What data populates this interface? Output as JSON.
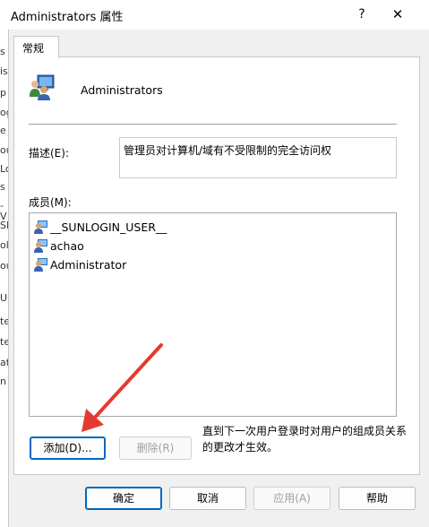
{
  "window": {
    "title": "Administrators 属性",
    "help_glyph": "?",
    "close_glyph": "✕"
  },
  "background_edge_chars": [
    "s",
    "is",
    "p",
    "og",
    "e",
    "ou",
    "Lo",
    "s",
    "-V",
    "SP",
    "ol",
    "ou",
    "U",
    "te",
    "te",
    "at",
    "n"
  ],
  "tab": {
    "label": "常规"
  },
  "group": {
    "name": "Administrators",
    "icon": "group-users-icon"
  },
  "description": {
    "label": "描述(E):",
    "value": "管理员对计算机/域有不受限制的完全访问权"
  },
  "members": {
    "label": "成员(M):",
    "items": [
      "__SUNLOGIN_USER__",
      "achao",
      "Administrator"
    ],
    "item_icon": "user-icon"
  },
  "buttons": {
    "add": "添加(D)...",
    "remove": "删除(R)",
    "ok": "确定",
    "cancel": "取消",
    "apply": "应用(A)",
    "help": "帮助"
  },
  "note": "直到下一次用户登录时对用户的组成员关系的更改才生效。",
  "colors": {
    "accent": "#0067c0",
    "arrow": "#e53a2f",
    "disabled_text": "#a0a0a0"
  }
}
